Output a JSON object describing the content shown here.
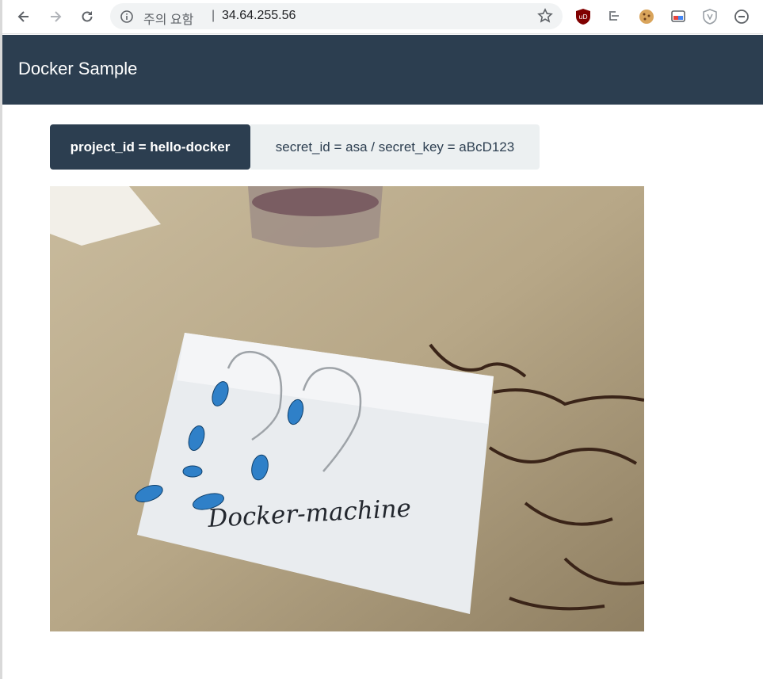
{
  "browser": {
    "security_label": "주의 요함",
    "separator": "|",
    "url": "34.64.255.56",
    "icons": [
      "back-icon",
      "forward-icon",
      "reload-icon",
      "info-icon",
      "star-icon",
      "ublock-icon",
      "tree-icon",
      "cookie-icon",
      "cast-icon",
      "shield-icon",
      "minus-circle-icon"
    ]
  },
  "header": {
    "title": "Docker Sample"
  },
  "tabs": [
    {
      "label": "project_id = hello-docker",
      "active": true
    },
    {
      "label": "secret_id = asa / secret_key = aBcD123",
      "active": false
    }
  ],
  "photo": {
    "card_text": "Docker-machine"
  },
  "colors": {
    "header_bg": "#2c3e50",
    "tab_inactive_bg": "#ecf0f1",
    "bead_blue": "#2f80c8"
  }
}
